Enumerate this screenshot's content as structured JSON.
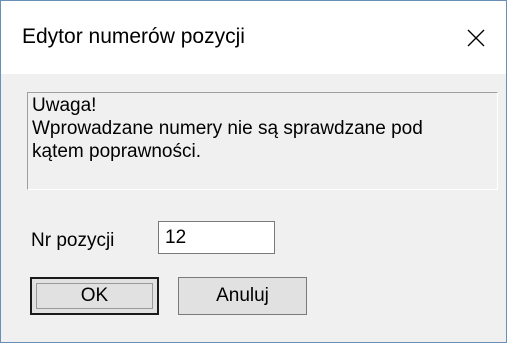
{
  "window": {
    "title": "Edytor numerów pozycji"
  },
  "notice": {
    "lines": [
      "Uwaga!",
      "Wprowadzane numery nie są sprawdzane pod",
      "kątem poprawności."
    ]
  },
  "field": {
    "label": "Nr pozycji",
    "value": "12"
  },
  "buttons": {
    "ok_label": "OK",
    "cancel_label": "Anuluj"
  },
  "icons": {
    "close": "close-icon"
  },
  "colors": {
    "window_border": "#6a8fb5",
    "dialog_background": "#f0f0f0",
    "titlebar_background": "#ffffff",
    "button_face": "#e1e1e1"
  }
}
